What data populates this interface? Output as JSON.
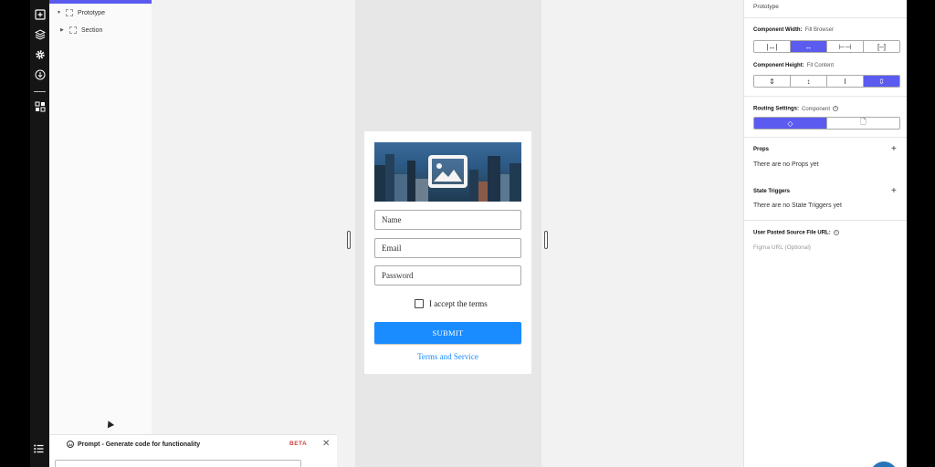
{
  "tree": {
    "items": [
      {
        "label": "Prototype"
      },
      {
        "label": "Section"
      }
    ]
  },
  "form": {
    "name_placeholder": "Name",
    "email_placeholder": "Email",
    "password_placeholder": "Password",
    "terms_label": "I accept the terms",
    "submit_label": "SUBMIT",
    "tos_link": "Terms and Service"
  },
  "prompt": {
    "ai_badge": "AI",
    "title": "Prompt - Generate code for functionality",
    "beta": "BETA"
  },
  "panel": {
    "header": "Prototype",
    "width": {
      "label": "Component Width:",
      "value": "Fill Browser"
    },
    "height": {
      "label": "Component Height:",
      "value": "Fit Content"
    },
    "routing": {
      "label": "Routing Settings:",
      "value": "Component"
    },
    "props": {
      "title": "Props",
      "empty": "There are no Props yet"
    },
    "triggers": {
      "title": "State Triggers",
      "empty": "There are no State Triggers yet"
    },
    "source": {
      "title": "User Pasted Source File URL:",
      "placeholder": "Figma URL (Optional)"
    }
  },
  "colors": {
    "accent": "#5b5bf0",
    "submit": "#1a8cff",
    "rail": "#151515"
  }
}
